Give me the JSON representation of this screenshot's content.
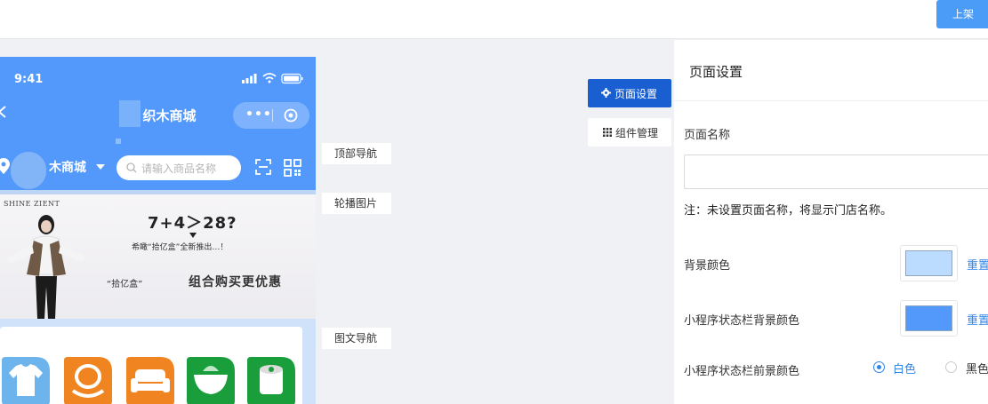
{
  "toolbar": {
    "publish_label": "上架"
  },
  "phone": {
    "status_time": "9:41",
    "shop_title": "织木商城",
    "capsule_dots": "•••",
    "store_name": "木商城",
    "search_placeholder": "请输入商品名称"
  },
  "banner": {
    "brand": "SHINE ZIENT",
    "equation": "7+4＞28?",
    "subtitle": "希瞰“拾亿盒”全新推出…！",
    "tag": "“拾亿盒”",
    "headline": "组合购买更优惠"
  },
  "tools": {
    "page_settings": "页面设置",
    "component_manage": "组件管理"
  },
  "component_tags": {
    "top_nav": "顶部导航",
    "carousel": "轮播图片",
    "image_text_nav": "图文导航"
  },
  "panel": {
    "title": "页面设置",
    "page_name_label": "页面名称",
    "page_name_value": "",
    "note": "注：未设置页面名称，将显示门店名称。",
    "bg_color_label": "背景颜色",
    "bg_color": "#bcdcff",
    "statusbar_bg_label": "小程序状态栏背景颜色",
    "statusbar_bg_color": "#5399fb",
    "reset_label": "重置",
    "statusbar_fg_label": "小程序状态栏前景颜色",
    "fg_options": [
      "白色",
      "黑色"
    ],
    "fg_selected": "白色"
  },
  "colors": {
    "accent": "#2f86e8",
    "header_blue": "#5399fb",
    "primary_button": "#1a5fd2"
  }
}
